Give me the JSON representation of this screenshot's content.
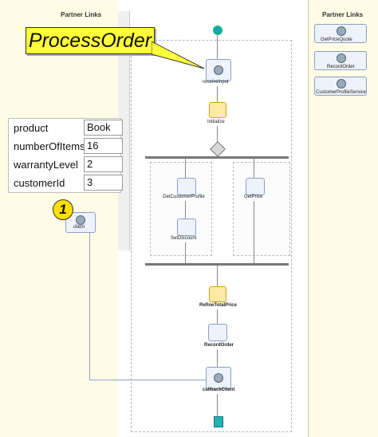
{
  "partner_links_left": {
    "title": "Partner Links"
  },
  "partner_links_right": {
    "title": "Partner Links",
    "items": [
      "GetPriceQuote",
      "RecordOrder",
      "CustomerProfileService"
    ]
  },
  "callout": {
    "text": "ProcessOrder"
  },
  "step_badge": {
    "number": "1"
  },
  "client": {
    "label": "client"
  },
  "input_table": {
    "rows": [
      {
        "key": "product",
        "value": "Book"
      },
      {
        "key": "numberOfItems",
        "value": "16"
      },
      {
        "key": "warrantyLevel",
        "value": "2"
      },
      {
        "key": "customerId",
        "value": "3"
      }
    ]
  },
  "process": {
    "receive": "receiveInput",
    "initialize": "Initialize",
    "branch1_act1": "GetCustomerProfile",
    "branch1_act2": "SetDiscount",
    "branch2_act1": "GetPrice",
    "refine": "RefineTotalPrice",
    "record": "RecordOrder",
    "callback": "callbackClient"
  }
}
